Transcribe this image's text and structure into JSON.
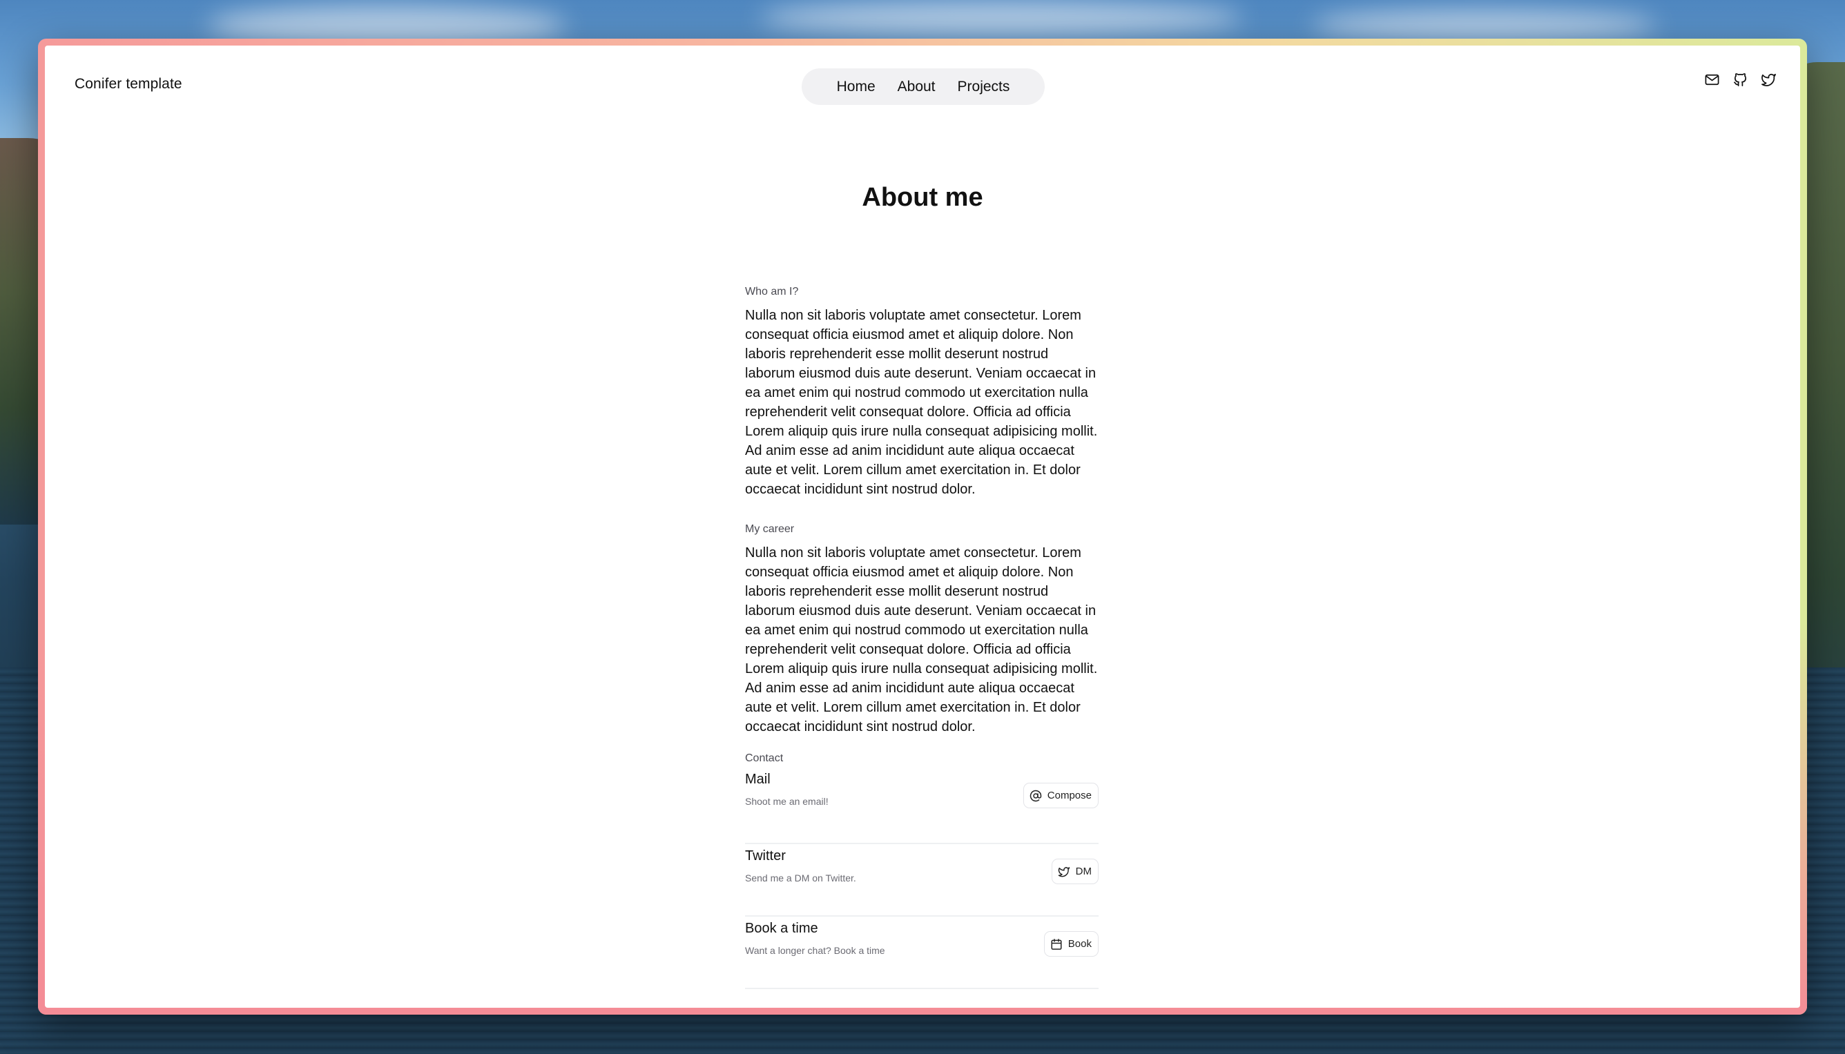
{
  "site": {
    "brand": "Conifer template"
  },
  "nav": {
    "items": [
      "Home",
      "About",
      "Projects"
    ]
  },
  "social": {
    "icons": [
      "mail-icon",
      "github-icon",
      "twitter-icon"
    ]
  },
  "page": {
    "title": "About me"
  },
  "sections": [
    {
      "label": "Who am I?",
      "text": "Nulla non sit laboris voluptate amet consectetur. Lorem consequat officia eiusmod amet et aliquip dolore. Non laboris reprehenderit esse mollit deserunt nostrud laborum eiusmod duis aute deserunt. Veniam occaecat in ea amet enim qui nostrud commodo ut exercitation nulla reprehenderit velit consequat dolore. Officia ad officia Lorem aliquip quis irure nulla consequat adipisicing mollit. Ad anim esse ad anim incididunt aute aliqua occaecat aute et velit. Lorem cillum amet exercitation in. Et dolor occaecat incididunt sint nostrud dolor."
    },
    {
      "label": "My career",
      "text": "Nulla non sit laboris voluptate amet consectetur. Lorem consequat officia eiusmod amet et aliquip dolore. Non laboris reprehenderit esse mollit deserunt nostrud laborum eiusmod duis aute deserunt. Veniam occaecat in ea amet enim qui nostrud commodo ut exercitation nulla reprehenderit velit consequat dolore. Officia ad officia Lorem aliquip quis irure nulla consequat adipisicing mollit. Ad anim esse ad anim incididunt aute aliqua occaecat aute et velit. Lorem cillum amet exercitation in. Et dolor occaecat incididunt sint nostrud dolor."
    }
  ],
  "contact": {
    "label": "Contact",
    "items": [
      {
        "title": "Mail",
        "subtitle": "Shoot me an email!",
        "button": "Compose",
        "icon": "at-sign-icon"
      },
      {
        "title": "Twitter",
        "subtitle": "Send me a DM on Twitter.",
        "button": "DM",
        "icon": "twitter-icon"
      },
      {
        "title": "Book a time",
        "subtitle": "Want a longer chat? Book a time",
        "button": "Book",
        "icon": "calendar-icon"
      }
    ]
  },
  "colors": {
    "frame_gradient": [
      "#f59a9a",
      "#f3d9a0",
      "#dbe99b"
    ],
    "nav_background": "#f1f1f3",
    "text": "#111111",
    "muted_text": "#6b6b73"
  }
}
